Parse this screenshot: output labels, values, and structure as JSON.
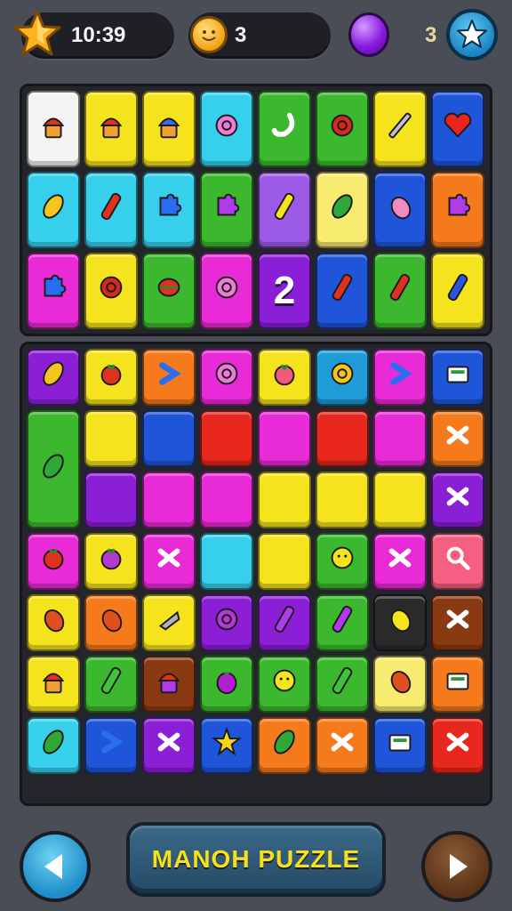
{
  "hud": {
    "time": "10:39",
    "coins": "3",
    "gems": "3",
    "star_icon": "star-icon",
    "coin_icon": "coin-icon",
    "gem_icon": "purple-gem-icon",
    "favorite_icon": "star-button-icon"
  },
  "footer": {
    "title": "MANOH PUZZLE",
    "prev_icon": "arrow-left-icon",
    "next_icon": "arrow-right-icon"
  },
  "board_top": {
    "rows": [
      [
        {
          "color": "#f4f4f4",
          "icon": "cupcake",
          "glyph": ""
        },
        {
          "color": "#f5e31e",
          "icon": "ice-cream-face",
          "glyph": ""
        },
        {
          "color": "#f5e31e",
          "icon": "crown-cake",
          "glyph": ""
        },
        {
          "color": "#36d0ec",
          "icon": "pink-rose",
          "glyph": ""
        },
        {
          "color": "#3bb82e",
          "icon": "white-hook",
          "glyph": ""
        },
        {
          "color": "#3bb82e",
          "icon": "red-pepper-flower",
          "glyph": ""
        },
        {
          "color": "#f5e31e",
          "icon": "pencil",
          "glyph": ""
        },
        {
          "color": "#1f55d8",
          "icon": "red-heart",
          "glyph": ""
        }
      ],
      [
        {
          "color": "#36d0ec",
          "icon": "leaf",
          "glyph": ""
        },
        {
          "color": "#36d0ec",
          "icon": "red-candy-stick",
          "glyph": ""
        },
        {
          "color": "#36d0ec",
          "icon": "blue-puzzle",
          "glyph": ""
        },
        {
          "color": "#3bb82e",
          "icon": "purple-puzzle",
          "glyph": ""
        },
        {
          "color": "#9b5be6",
          "icon": "yellow-stick",
          "glyph": ""
        },
        {
          "color": "#f8ec70",
          "icon": "green-leaf",
          "glyph": ""
        },
        {
          "color": "#1f55d8",
          "icon": "pink-turnip",
          "glyph": ""
        },
        {
          "color": "#f57a1c",
          "icon": "purple-puzzle",
          "glyph": ""
        }
      ],
      [
        {
          "color": "#e82bd6",
          "icon": "blue-puzzle",
          "glyph": ""
        },
        {
          "color": "#f5e31e",
          "icon": "red-rose",
          "glyph": ""
        },
        {
          "color": "#3bb82e",
          "icon": "red-drum",
          "glyph": ""
        },
        {
          "color": "#e82bd6",
          "icon": "pink-flower",
          "glyph": ""
        },
        {
          "color": "#8b1fd6",
          "icon": "number-two",
          "glyph": "2"
        },
        {
          "color": "#1f55d8",
          "icon": "red-stick",
          "glyph": ""
        },
        {
          "color": "#3bb82e",
          "icon": "red-stick",
          "glyph": ""
        },
        {
          "color": "#f5e31e",
          "icon": "blue-leek",
          "glyph": ""
        }
      ]
    ]
  },
  "board_bottom": {
    "rows": [
      [
        {
          "color": "#8b1fd6",
          "icon": "maple-leaf"
        },
        {
          "color": "#f5e31e",
          "icon": "tomato"
        },
        {
          "color": "#f57a1c",
          "icon": "blue-chevron"
        },
        {
          "color": "#e82bd6",
          "icon": "purple-swirl"
        },
        {
          "color": "#f5e31e",
          "icon": "berry"
        },
        {
          "color": "#1f9bd8",
          "icon": "yellow-flower"
        },
        {
          "color": "#e82bd6",
          "icon": "blue-sock"
        },
        {
          "color": "#1f55d8",
          "icon": "green-box"
        }
      ],
      [
        {
          "color": "#3bb82e",
          "icon": "green-squash"
        },
        {
          "color": "#f5e31e",
          "icon": ""
        },
        {
          "color": "#1f55d8",
          "icon": ""
        },
        {
          "color": "#e8281e",
          "icon": ""
        },
        {
          "color": "#e82bd6",
          "icon": ""
        },
        {
          "color": "#e8281e",
          "icon": ""
        },
        {
          "color": "#e82bd6",
          "icon": ""
        },
        {
          "color": "#f57a1c",
          "icon": "cross-mark"
        }
      ],
      [
        {
          "color": "#8b1fd6",
          "icon": ""
        },
        {
          "color": "#e82bd6",
          "icon": ""
        },
        {
          "color": "#e82bd6",
          "icon": ""
        },
        {
          "color": "#f5e31e",
          "icon": ""
        },
        {
          "color": "#f5e31e",
          "icon": ""
        },
        {
          "color": "#f5e31e",
          "icon": ""
        },
        {
          "color": "#8b1fd6",
          "icon": "wave"
        }
      ],
      [
        {
          "color": "#e82bd6",
          "icon": "red-ball"
        },
        {
          "color": "#f5e31e",
          "icon": "raspberry"
        },
        {
          "color": "#e82bd6",
          "icon": "white-zigzag"
        },
        {
          "color": "#36d0ec",
          "icon": ""
        },
        {
          "color": "#f5e31e",
          "icon": ""
        },
        {
          "color": "#3bb82e",
          "icon": "yellow-lemon"
        },
        {
          "color": "#e82bd6",
          "icon": "white-knot"
        },
        {
          "color": "#f55f82",
          "icon": "magnifier"
        }
      ],
      [
        {
          "color": "#f5e31e",
          "icon": "sausages"
        },
        {
          "color": "#f57a1c",
          "icon": "red-pepper"
        },
        {
          "color": "#f5e31e",
          "icon": "grey-cone"
        },
        {
          "color": "#8b1fd6",
          "icon": "purple-ring"
        },
        {
          "color": "#8b1fd6",
          "icon": "purple-bar"
        },
        {
          "color": "#3bb82e",
          "icon": "purple-bar"
        },
        {
          "color": "#2a2a2a",
          "icon": "yellow-pepper"
        },
        {
          "color": "#8a3a12",
          "icon": "white-cross"
        }
      ],
      [
        {
          "color": "#f5e31e",
          "icon": "golden-cake"
        },
        {
          "color": "#3bb82e",
          "icon": "green-cucumber"
        },
        {
          "color": "#8a3a12",
          "icon": "purple-pot"
        },
        {
          "color": "#3bb82e",
          "icon": "eggplant"
        },
        {
          "color": "#3bb82e",
          "icon": "yellow-coin"
        },
        {
          "color": "#3bb82e",
          "icon": "green-cucumber"
        },
        {
          "color": "#f8ec70",
          "icon": "red-onion"
        },
        {
          "color": "#f57a1c",
          "icon": "cash-register"
        }
      ],
      [
        {
          "color": "#36d0ec",
          "icon": "spinach"
        },
        {
          "color": "#1f55d8",
          "icon": "blue-bottle"
        },
        {
          "color": "#8b1fd6",
          "icon": "white-cross"
        },
        {
          "color": "#1f55d8",
          "icon": "yellow-star"
        },
        {
          "color": "#f57a1c",
          "icon": "green-leaf"
        },
        {
          "color": "#f57a1c",
          "icon": "white-knot"
        },
        {
          "color": "#1f55d8",
          "icon": "basket"
        },
        {
          "color": "#e8281e",
          "icon": "white-mustache"
        }
      ]
    ]
  }
}
